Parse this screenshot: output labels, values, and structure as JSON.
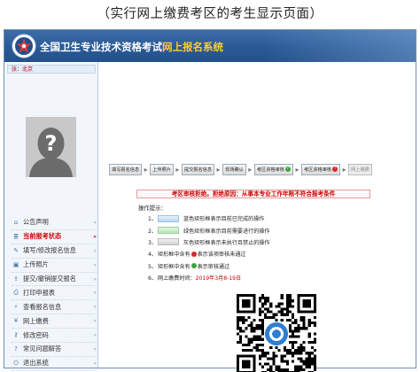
{
  "caption": "（实行网上缴费考区的考生显示页面）",
  "header": {
    "title_main": "全国卫生专业技术资格考试",
    "title_accent": "网上报名系统"
  },
  "user": {
    "label": "张：北京"
  },
  "menu": [
    {
      "icon": "home-icon",
      "label": "公告声明",
      "active": false
    },
    {
      "icon": "list-icon",
      "label": "当前报考状态",
      "active": true
    },
    {
      "icon": "edit-icon",
      "label": "填写/修改报名信息",
      "active": false
    },
    {
      "icon": "photo-icon",
      "label": "上传照片",
      "active": false
    },
    {
      "icon": "submit-icon",
      "label": "提交/撤销提交报名",
      "active": false
    },
    {
      "icon": "print-icon",
      "label": "打印申报表",
      "active": false
    },
    {
      "icon": "search-icon",
      "label": "查看报名信息",
      "active": false
    },
    {
      "icon": "payment-icon",
      "label": "网上缴费",
      "active": false
    },
    {
      "icon": "key-icon",
      "label": "修改密码",
      "active": false
    },
    {
      "icon": "help-icon",
      "label": "常见问题解答",
      "active": false
    },
    {
      "icon": "exit-icon",
      "label": "退出系统",
      "active": false
    }
  ],
  "steps": [
    {
      "label": "填写报名信息",
      "state": "done"
    },
    {
      "label": "上传照片",
      "state": "done"
    },
    {
      "label": "提交报名信息",
      "state": "done"
    },
    {
      "label": "现场确认",
      "state": "done"
    },
    {
      "label": "考区资格审核",
      "state": "approved"
    },
    {
      "label": "考区资格审核",
      "state": "rejected"
    },
    {
      "label": "网上缴费",
      "state": "disabled"
    }
  ],
  "reject_notice": "考区审核拒绝。拒绝原因：从事本专业工作年限不符合报考条件",
  "guide": {
    "title": "操作提示：",
    "items": [
      {
        "num": "1、",
        "swatch": "blue",
        "text": "蓝色矩形框表示目前已完成的操作"
      },
      {
        "num": "2、",
        "swatch": "green",
        "text": "绿色矩形框表示目前需要进行的操作"
      },
      {
        "num": "3、",
        "swatch": "gray",
        "text": "灰色矩形框表示未执行且禁止的操作"
      },
      {
        "num": "4、",
        "pre": "矩形框中含有",
        "dot": "red",
        "post": "表示该项审核未通过"
      },
      {
        "num": "5、",
        "pre": "矩形框中含有",
        "dot": "green",
        "post": "表示审核通过"
      },
      {
        "num": "6、",
        "pre": "网上缴费时间：",
        "highlight": "2019年3月8-19日"
      }
    ]
  },
  "colors": {
    "header": "#2a5a96",
    "accent": "#ffcc33",
    "reject": "#cc0000",
    "ok": "#3aa53a",
    "bad": "#d42a2a"
  }
}
